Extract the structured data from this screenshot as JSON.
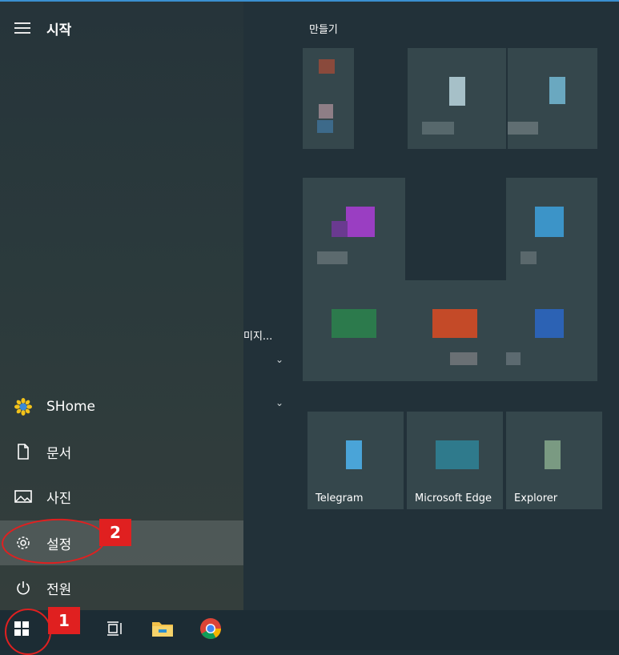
{
  "start_menu": {
    "title": "시작",
    "nav": [
      {
        "label": "SHome",
        "icon": "sunflower-icon"
      },
      {
        "label": "문서",
        "icon": "document-icon"
      },
      {
        "label": "사진",
        "icon": "picture-icon"
      },
      {
        "label": "설정",
        "icon": "gear-icon"
      },
      {
        "label": "전원",
        "icon": "power-icon"
      }
    ],
    "truncated_app_text": "미지...",
    "tile_group_title": "만들기",
    "tiles": [
      {
        "label": "Telegram"
      },
      {
        "label": "Microsoft Edge"
      },
      {
        "label": "Explorer"
      }
    ]
  },
  "annotations": {
    "step1": "1",
    "step2": "2"
  },
  "colors": {
    "accent": "#3a8fd0",
    "annotation_red": "#e02020",
    "taskbar": "#1c2c34"
  }
}
